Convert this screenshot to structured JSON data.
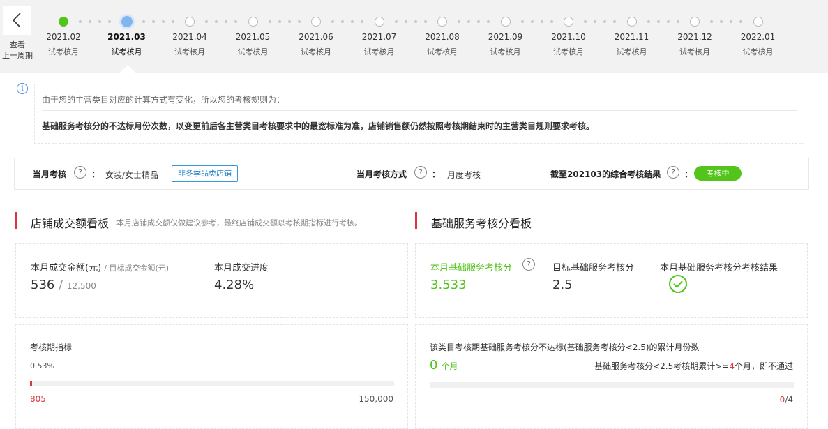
{
  "timeline": {
    "back_label_line1": "查看",
    "back_label_line2": "上一周期",
    "months": [
      {
        "date": "2021.02",
        "sub": "试考核月",
        "state": "done"
      },
      {
        "date": "2021.03",
        "sub": "试考核月",
        "state": "active"
      },
      {
        "date": "2021.04",
        "sub": "试考核月",
        "state": "future"
      },
      {
        "date": "2021.05",
        "sub": "试考核月",
        "state": "future"
      },
      {
        "date": "2021.06",
        "sub": "试考核月",
        "state": "future"
      },
      {
        "date": "2021.07",
        "sub": "试考核月",
        "state": "future"
      },
      {
        "date": "2021.08",
        "sub": "试考核月",
        "state": "future"
      },
      {
        "date": "2021.09",
        "sub": "试考核月",
        "state": "future"
      },
      {
        "date": "2021.10",
        "sub": "试考核月",
        "state": "future"
      },
      {
        "date": "2021.11",
        "sub": "试考核月",
        "state": "future"
      },
      {
        "date": "2021.12",
        "sub": "试考核月",
        "state": "future"
      },
      {
        "date": "2022.01",
        "sub": "试考核月",
        "state": "future"
      }
    ]
  },
  "notice": {
    "line1": "由于您的主营类目对应的计算方式有变化，所以您的考核规则为：",
    "line2": "基础服务考核分的不达标月份次数，以变更前后各主营类目考核要求中的最宽标准为准，店铺销售额仍然按照考核期结束时的主营类目规则要求考核。"
  },
  "info_bar": {
    "category_label": "当月考核",
    "category_value": "女装/女士精品",
    "category_tag": "非冬季品类店铺",
    "method_label": "当月考核方式",
    "method_value": "月度考核",
    "result_label": "截至202103的综合考核结果",
    "result_tag": "考核中",
    "colon": "："
  },
  "left_section": {
    "title": "店铺成交额看板",
    "note": "本月店铺成交额仅做建议参考，最终店铺成交额以考核期指标进行考核。",
    "amount_label": "本月成交金额(元)",
    "target_label": "/ 目标成交金额(元)",
    "amount_value": "536",
    "slash": "/",
    "target_value": "12,500",
    "progress_label": "本月成交进度",
    "progress_value": "4.28%",
    "period_label": "考核期指标",
    "period_percent": "0.53%",
    "period_fraction": 0.0053,
    "period_current": "805",
    "period_target": "150,000"
  },
  "right_section": {
    "title": "基础服务考核分看板",
    "score_label": "本月基础服务考核分",
    "score_value": "3.533",
    "target_label": "目标基础服务考核分",
    "target_value": "2.5",
    "result_label": "本月基础服务考核分考核结果",
    "cumulative_label": "该类目考核期基础服务考核分不达标(基础服务考核分<2.5)的累计月份数",
    "cumulative_count": "0",
    "cumulative_unit": "个月",
    "rule_prefix": "基础服务考核分<2.5考核期累计>=",
    "rule_num": "4",
    "rule_suffix": "个月，即不通过",
    "ratio_current": "0",
    "ratio_total": "/4"
  },
  "colors": {
    "accent_red": "#d9363e",
    "accent_green": "#52c41a",
    "accent_blue": "#4a90e2"
  }
}
